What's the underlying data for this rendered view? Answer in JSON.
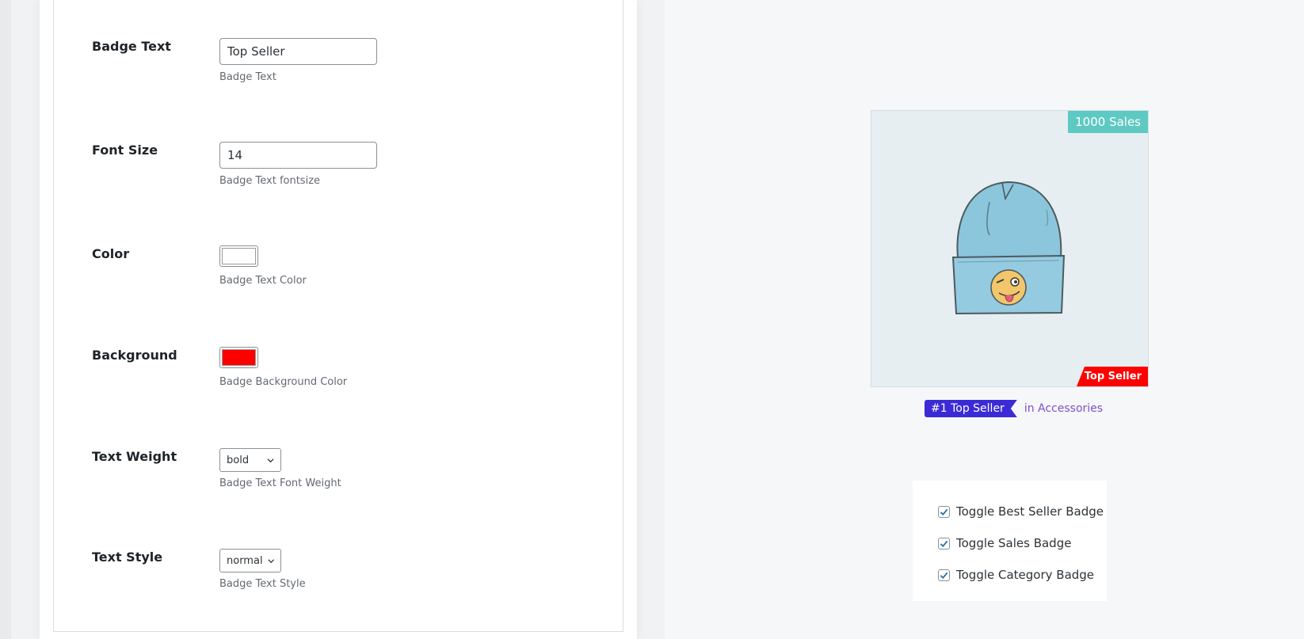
{
  "settings": {
    "fields": [
      {
        "label": "Badge Text",
        "value": "Top Seller",
        "help": "Badge Text"
      },
      {
        "label": "Font Size",
        "value": "14",
        "help": "Badge Text fontsize"
      },
      {
        "label": "Color",
        "value": "#ffffff",
        "help": "Badge Text Color"
      },
      {
        "label": "Background",
        "value": "#ff0000",
        "help": "Badge Background Color"
      },
      {
        "label": "Text Weight",
        "value": "bold",
        "help": "Badge Text Font Weight"
      },
      {
        "label": "Text Style",
        "value": "normal",
        "help": "Badge Text Style"
      }
    ]
  },
  "preview": {
    "sales_badge": "1000 Sales",
    "top_seller_badge": "Top Seller",
    "rank_label": "#1 Top Seller",
    "category_text": "in Accessories",
    "product_image_icon": "beanie-hat-with-winking-emoji",
    "colors": {
      "sales_badge": "#5ec9c2",
      "top_seller_badge": "#ff0000",
      "rank_ribbon": "#3b2bd6",
      "category_link": "#7b51c9",
      "checkbox_check": "#2271b1"
    }
  },
  "toggles": [
    {
      "label": "Toggle Best Seller Badge",
      "checked": true
    },
    {
      "label": "Toggle Sales Badge",
      "checked": true
    },
    {
      "label": "Toggle Category Badge",
      "checked": true
    }
  ]
}
